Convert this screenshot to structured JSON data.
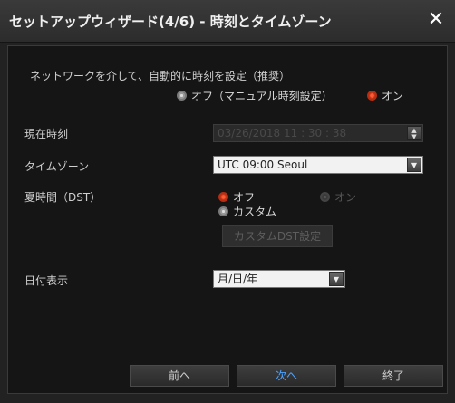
{
  "window": {
    "title": "セットアップウィザード(4/6) - 時刻とタイムゾーン",
    "close_glyph": "✕"
  },
  "auto_time": {
    "label": "ネットワークを介して、自動的に時刻を設定（推奨）",
    "option_off": "オフ（マニュアル時刻設定）",
    "option_on": "オン",
    "selected": "オン"
  },
  "current_time": {
    "label": "現在時刻",
    "value": "03/26/2018  11 : 30 : 38"
  },
  "timezone": {
    "label": "タイムゾーン",
    "value": "UTC 09:00 Seoul"
  },
  "dst": {
    "label": "夏時間（DST）",
    "option_off": "オフ",
    "option_on": "オン",
    "option_custom": "カスタム",
    "selected": "オフ",
    "custom_button": "カスタムDST設定"
  },
  "date_display": {
    "label": "日付表示",
    "value": "月/日/年"
  },
  "footer": {
    "prev": "前へ",
    "next": "次へ",
    "finish": "終了"
  },
  "colors": {
    "accent": "#ff5a33",
    "link_blue": "#4ea3ff"
  }
}
